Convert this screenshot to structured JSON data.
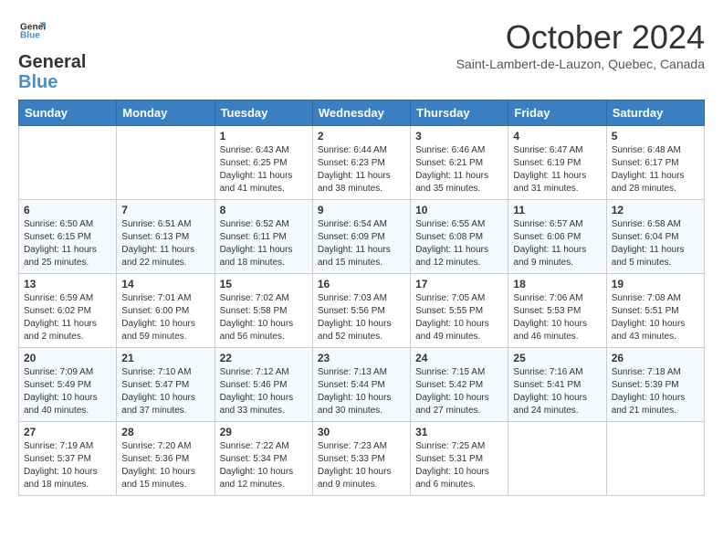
{
  "header": {
    "logo_line1": "General",
    "logo_line2": "Blue",
    "month": "October 2024",
    "location": "Saint-Lambert-de-Lauzon, Quebec, Canada"
  },
  "weekdays": [
    "Sunday",
    "Monday",
    "Tuesday",
    "Wednesday",
    "Thursday",
    "Friday",
    "Saturday"
  ],
  "weeks": [
    [
      {
        "day": "",
        "sunrise": "",
        "sunset": "",
        "daylight": ""
      },
      {
        "day": "",
        "sunrise": "",
        "sunset": "",
        "daylight": ""
      },
      {
        "day": "1",
        "sunrise": "Sunrise: 6:43 AM",
        "sunset": "Sunset: 6:25 PM",
        "daylight": "Daylight: 11 hours and 41 minutes."
      },
      {
        "day": "2",
        "sunrise": "Sunrise: 6:44 AM",
        "sunset": "Sunset: 6:23 PM",
        "daylight": "Daylight: 11 hours and 38 minutes."
      },
      {
        "day": "3",
        "sunrise": "Sunrise: 6:46 AM",
        "sunset": "Sunset: 6:21 PM",
        "daylight": "Daylight: 11 hours and 35 minutes."
      },
      {
        "day": "4",
        "sunrise": "Sunrise: 6:47 AM",
        "sunset": "Sunset: 6:19 PM",
        "daylight": "Daylight: 11 hours and 31 minutes."
      },
      {
        "day": "5",
        "sunrise": "Sunrise: 6:48 AM",
        "sunset": "Sunset: 6:17 PM",
        "daylight": "Daylight: 11 hours and 28 minutes."
      }
    ],
    [
      {
        "day": "6",
        "sunrise": "Sunrise: 6:50 AM",
        "sunset": "Sunset: 6:15 PM",
        "daylight": "Daylight: 11 hours and 25 minutes."
      },
      {
        "day": "7",
        "sunrise": "Sunrise: 6:51 AM",
        "sunset": "Sunset: 6:13 PM",
        "daylight": "Daylight: 11 hours and 22 minutes."
      },
      {
        "day": "8",
        "sunrise": "Sunrise: 6:52 AM",
        "sunset": "Sunset: 6:11 PM",
        "daylight": "Daylight: 11 hours and 18 minutes."
      },
      {
        "day": "9",
        "sunrise": "Sunrise: 6:54 AM",
        "sunset": "Sunset: 6:09 PM",
        "daylight": "Daylight: 11 hours and 15 minutes."
      },
      {
        "day": "10",
        "sunrise": "Sunrise: 6:55 AM",
        "sunset": "Sunset: 6:08 PM",
        "daylight": "Daylight: 11 hours and 12 minutes."
      },
      {
        "day": "11",
        "sunrise": "Sunrise: 6:57 AM",
        "sunset": "Sunset: 6:06 PM",
        "daylight": "Daylight: 11 hours and 9 minutes."
      },
      {
        "day": "12",
        "sunrise": "Sunrise: 6:58 AM",
        "sunset": "Sunset: 6:04 PM",
        "daylight": "Daylight: 11 hours and 5 minutes."
      }
    ],
    [
      {
        "day": "13",
        "sunrise": "Sunrise: 6:59 AM",
        "sunset": "Sunset: 6:02 PM",
        "daylight": "Daylight: 11 hours and 2 minutes."
      },
      {
        "day": "14",
        "sunrise": "Sunrise: 7:01 AM",
        "sunset": "Sunset: 6:00 PM",
        "daylight": "Daylight: 10 hours and 59 minutes."
      },
      {
        "day": "15",
        "sunrise": "Sunrise: 7:02 AM",
        "sunset": "Sunset: 5:58 PM",
        "daylight": "Daylight: 10 hours and 56 minutes."
      },
      {
        "day": "16",
        "sunrise": "Sunrise: 7:03 AM",
        "sunset": "Sunset: 5:56 PM",
        "daylight": "Daylight: 10 hours and 52 minutes."
      },
      {
        "day": "17",
        "sunrise": "Sunrise: 7:05 AM",
        "sunset": "Sunset: 5:55 PM",
        "daylight": "Daylight: 10 hours and 49 minutes."
      },
      {
        "day": "18",
        "sunrise": "Sunrise: 7:06 AM",
        "sunset": "Sunset: 5:53 PM",
        "daylight": "Daylight: 10 hours and 46 minutes."
      },
      {
        "day": "19",
        "sunrise": "Sunrise: 7:08 AM",
        "sunset": "Sunset: 5:51 PM",
        "daylight": "Daylight: 10 hours and 43 minutes."
      }
    ],
    [
      {
        "day": "20",
        "sunrise": "Sunrise: 7:09 AM",
        "sunset": "Sunset: 5:49 PM",
        "daylight": "Daylight: 10 hours and 40 minutes."
      },
      {
        "day": "21",
        "sunrise": "Sunrise: 7:10 AM",
        "sunset": "Sunset: 5:47 PM",
        "daylight": "Daylight: 10 hours and 37 minutes."
      },
      {
        "day": "22",
        "sunrise": "Sunrise: 7:12 AM",
        "sunset": "Sunset: 5:46 PM",
        "daylight": "Daylight: 10 hours and 33 minutes."
      },
      {
        "day": "23",
        "sunrise": "Sunrise: 7:13 AM",
        "sunset": "Sunset: 5:44 PM",
        "daylight": "Daylight: 10 hours and 30 minutes."
      },
      {
        "day": "24",
        "sunrise": "Sunrise: 7:15 AM",
        "sunset": "Sunset: 5:42 PM",
        "daylight": "Daylight: 10 hours and 27 minutes."
      },
      {
        "day": "25",
        "sunrise": "Sunrise: 7:16 AM",
        "sunset": "Sunset: 5:41 PM",
        "daylight": "Daylight: 10 hours and 24 minutes."
      },
      {
        "day": "26",
        "sunrise": "Sunrise: 7:18 AM",
        "sunset": "Sunset: 5:39 PM",
        "daylight": "Daylight: 10 hours and 21 minutes."
      }
    ],
    [
      {
        "day": "27",
        "sunrise": "Sunrise: 7:19 AM",
        "sunset": "Sunset: 5:37 PM",
        "daylight": "Daylight: 10 hours and 18 minutes."
      },
      {
        "day": "28",
        "sunrise": "Sunrise: 7:20 AM",
        "sunset": "Sunset: 5:36 PM",
        "daylight": "Daylight: 10 hours and 15 minutes."
      },
      {
        "day": "29",
        "sunrise": "Sunrise: 7:22 AM",
        "sunset": "Sunset: 5:34 PM",
        "daylight": "Daylight: 10 hours and 12 minutes."
      },
      {
        "day": "30",
        "sunrise": "Sunrise: 7:23 AM",
        "sunset": "Sunset: 5:33 PM",
        "daylight": "Daylight: 10 hours and 9 minutes."
      },
      {
        "day": "31",
        "sunrise": "Sunrise: 7:25 AM",
        "sunset": "Sunset: 5:31 PM",
        "daylight": "Daylight: 10 hours and 6 minutes."
      },
      {
        "day": "",
        "sunrise": "",
        "sunset": "",
        "daylight": ""
      },
      {
        "day": "",
        "sunrise": "",
        "sunset": "",
        "daylight": ""
      }
    ]
  ]
}
